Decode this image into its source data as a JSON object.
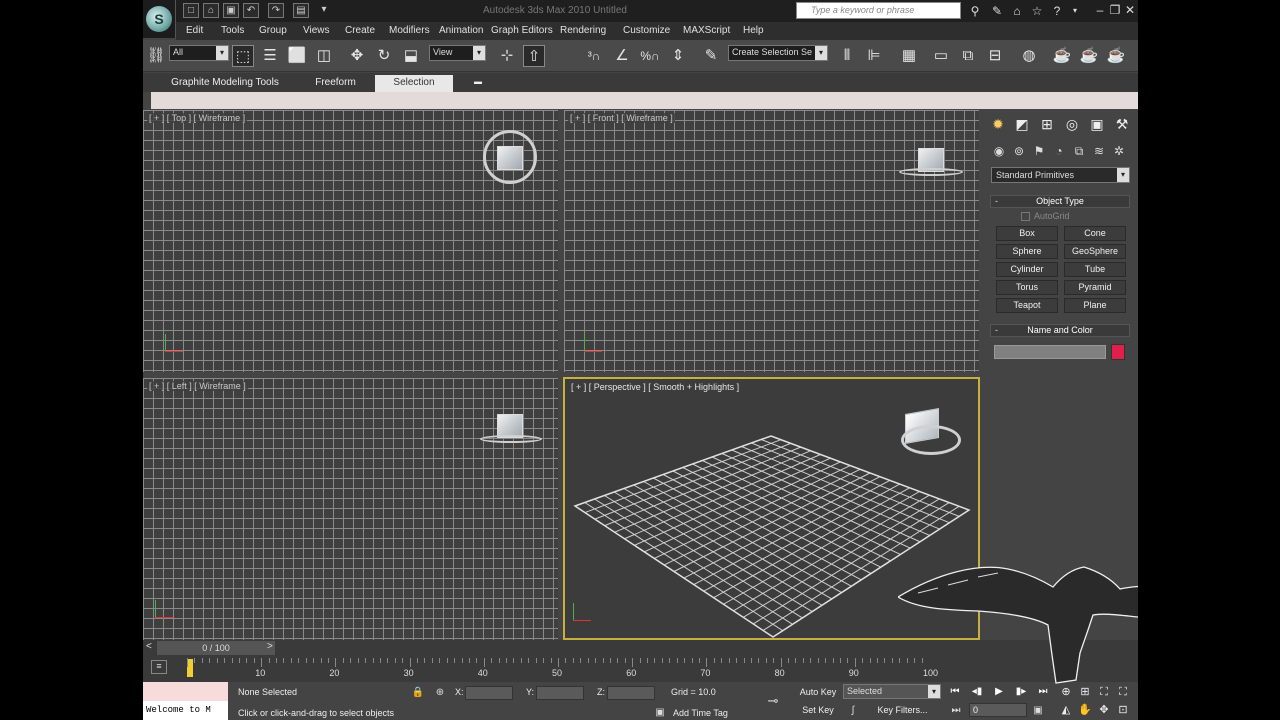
{
  "window": {
    "title": "Autodesk 3ds Max  2010      Untitled",
    "search_placeholder": "Type a keyword or phrase"
  },
  "menu": [
    "Edit",
    "Tools",
    "Group",
    "Views",
    "Create",
    "Modifiers",
    "Animation",
    "Graph Editors",
    "Rendering",
    "Customize",
    "MAXScript",
    "Help"
  ],
  "toolbar": {
    "filter_value": "All",
    "ref_coord_value": "View",
    "selection_set_placeholder": "Create Selection Se"
  },
  "ribbon": {
    "tabs": [
      "Graphite Modeling Tools",
      "Freeform",
      "Selection"
    ],
    "active_tab": "Selection"
  },
  "viewports": {
    "top": "[ + ] [ Top ] [ Wireframe ]",
    "front": "[ + ] [ Front ] [ Wireframe ]",
    "left": "[ + ] [ Left ] [ Wireframe ]",
    "perspective": "[ + ] [ Perspective ] [ Smooth + Highlights ]"
  },
  "command_panel": {
    "category": "Standard Primitives",
    "object_type_title": "Object Type",
    "autogrid_label": "AutoGrid",
    "buttons": [
      "Box",
      "Cone",
      "Sphere",
      "GeoSphere",
      "Cylinder",
      "Tube",
      "Torus",
      "Pyramid",
      "Teapot",
      "Plane"
    ],
    "name_color_title": "Name and Color",
    "color": "#e0204a"
  },
  "timeline": {
    "frame_display": "0 / 100",
    "ticks": [
      "10",
      "20",
      "30",
      "40",
      "50",
      "60",
      "70",
      "80",
      "90",
      "100"
    ]
  },
  "status": {
    "listener_text": "Welcome to M",
    "selection_info": "None Selected",
    "prompt": "Click or click-and-drag to select objects",
    "x_label": "X:",
    "y_label": "Y:",
    "z_label": "Z:",
    "grid": "Grid = 10.0",
    "add_time_tag": "Add Time Tag",
    "auto_key": "Auto Key",
    "set_key": "Set Key",
    "key_mode_value": "Selected",
    "key_filters": "Key Filters...",
    "current_frame": "0"
  }
}
